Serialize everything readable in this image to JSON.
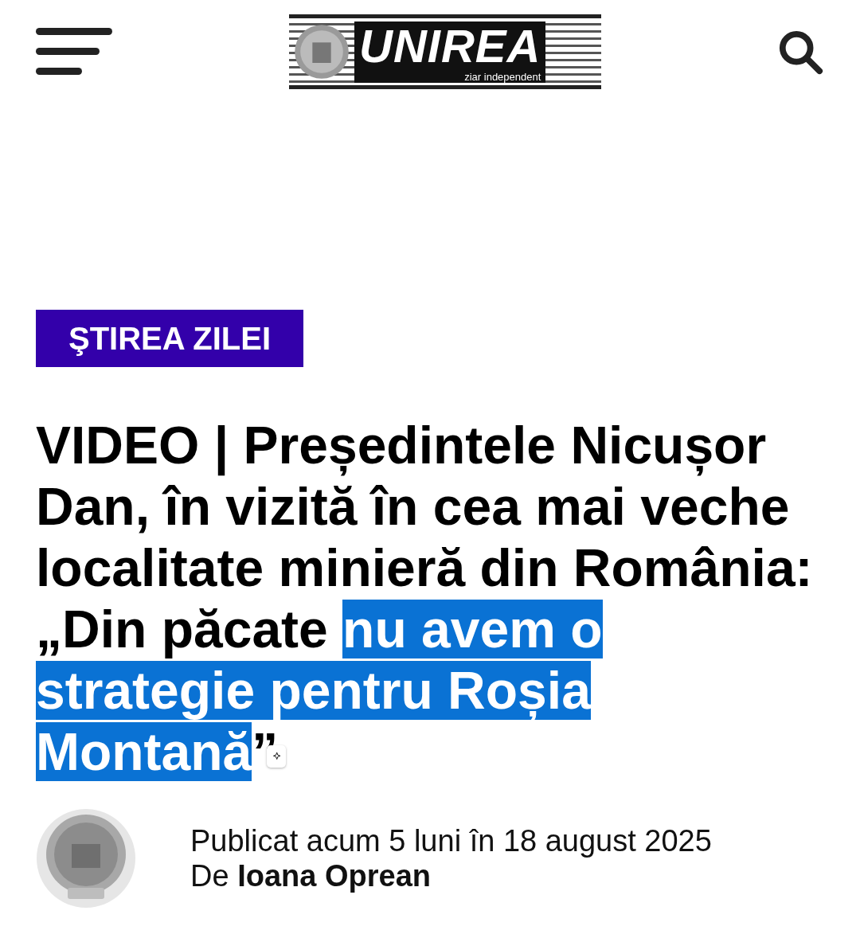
{
  "header": {
    "logo": {
      "title": "UNIREA",
      "tagline": "ziar independent"
    }
  },
  "category": "ŞTIREA ZILEI",
  "headline": [
    {
      "text": "VIDEO | Președintele Nicușor Dan, în vizită în cea mai veche localitate minieră din România: „Din păcate ",
      "selected": false
    },
    {
      "text": "nu avem o strategie pentru Roșia Montană",
      "selected": true
    },
    {
      "text": "”",
      "selected": false
    }
  ],
  "byline": {
    "published": "Publicat acum 5 luni în 18 august 2025",
    "by": "De",
    "author": "Ioana Oprean"
  }
}
